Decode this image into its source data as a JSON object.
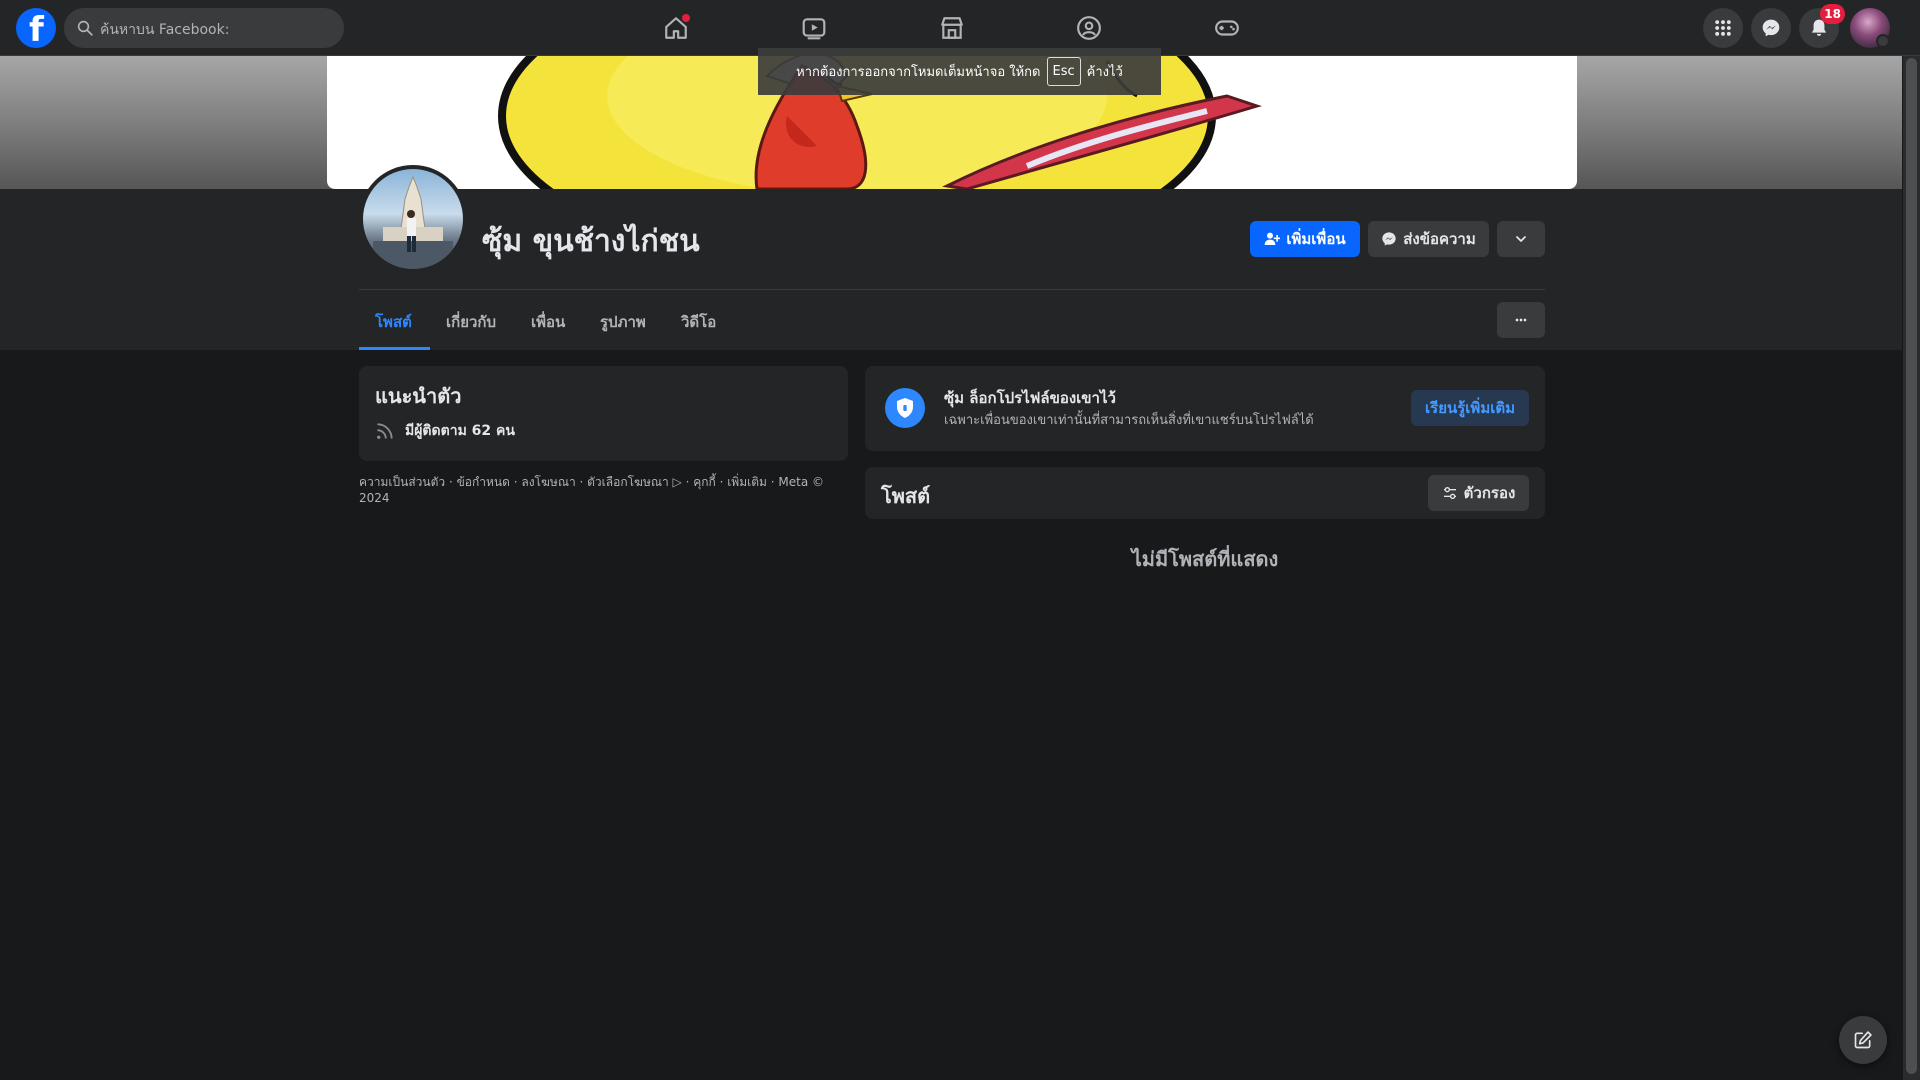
{
  "header": {
    "search_placeholder": "ค้นหาบน Facebook:",
    "notification_count": "18",
    "nav_icons": [
      "home-icon",
      "video-icon",
      "marketplace-icon",
      "groups-icon",
      "gaming-icon"
    ],
    "right_icons": [
      "menu-grid-icon",
      "messenger-icon",
      "bell-icon",
      "account-avatar"
    ]
  },
  "fullscreen_toast": {
    "before": "หากต้องการออกจากโหมดเต็มหน้าจอ ให้กด",
    "key": "Esc",
    "after": "ค้างไว้"
  },
  "profile": {
    "name": "ซุ้ม ขุนช้างไก่ชน",
    "add_friend_label": "เพิ่มเพื่อน",
    "message_label": "ส่งข้อความ"
  },
  "tabs": [
    {
      "label": "โพสต์",
      "active": true
    },
    {
      "label": "เกี่ยวกับ",
      "active": false
    },
    {
      "label": "เพื่อน",
      "active": false
    },
    {
      "label": "รูปภาพ",
      "active": false
    },
    {
      "label": "วิดีโอ",
      "active": false
    }
  ],
  "intro": {
    "title": "แนะนำตัว",
    "followers": "มีผู้ติดตาม 62 คน"
  },
  "footer": {
    "links": "ความเป็นส่วนตัว · ข้อกำหนด · ลงโฆษณา · ตัวเลือกโฆษณา ▷ · คุกกี้ · เพิ่มเติม · Meta © 2024"
  },
  "locked_notice": {
    "title": "ซุ้ม ล็อกโปรไฟล์ของเขาไว้",
    "subtitle": "เฉพาะเพื่อนของเขาเท่านั้นที่สามารถเห็นสิ่งที่เขาแชร์บนโปรไฟล์ได้",
    "learn_more_label": "เรียนรู้เพิ่มเติม"
  },
  "posts": {
    "title": "โพสต์",
    "filter_label": "ตัวกรอง",
    "empty_message": "ไม่มีโพสต์ที่แสดง"
  },
  "colors": {
    "accent": "#0866ff",
    "link_blue": "#2d88ff",
    "badge_red": "#e41e3f",
    "background": "#18191a",
    "card": "#242526"
  }
}
